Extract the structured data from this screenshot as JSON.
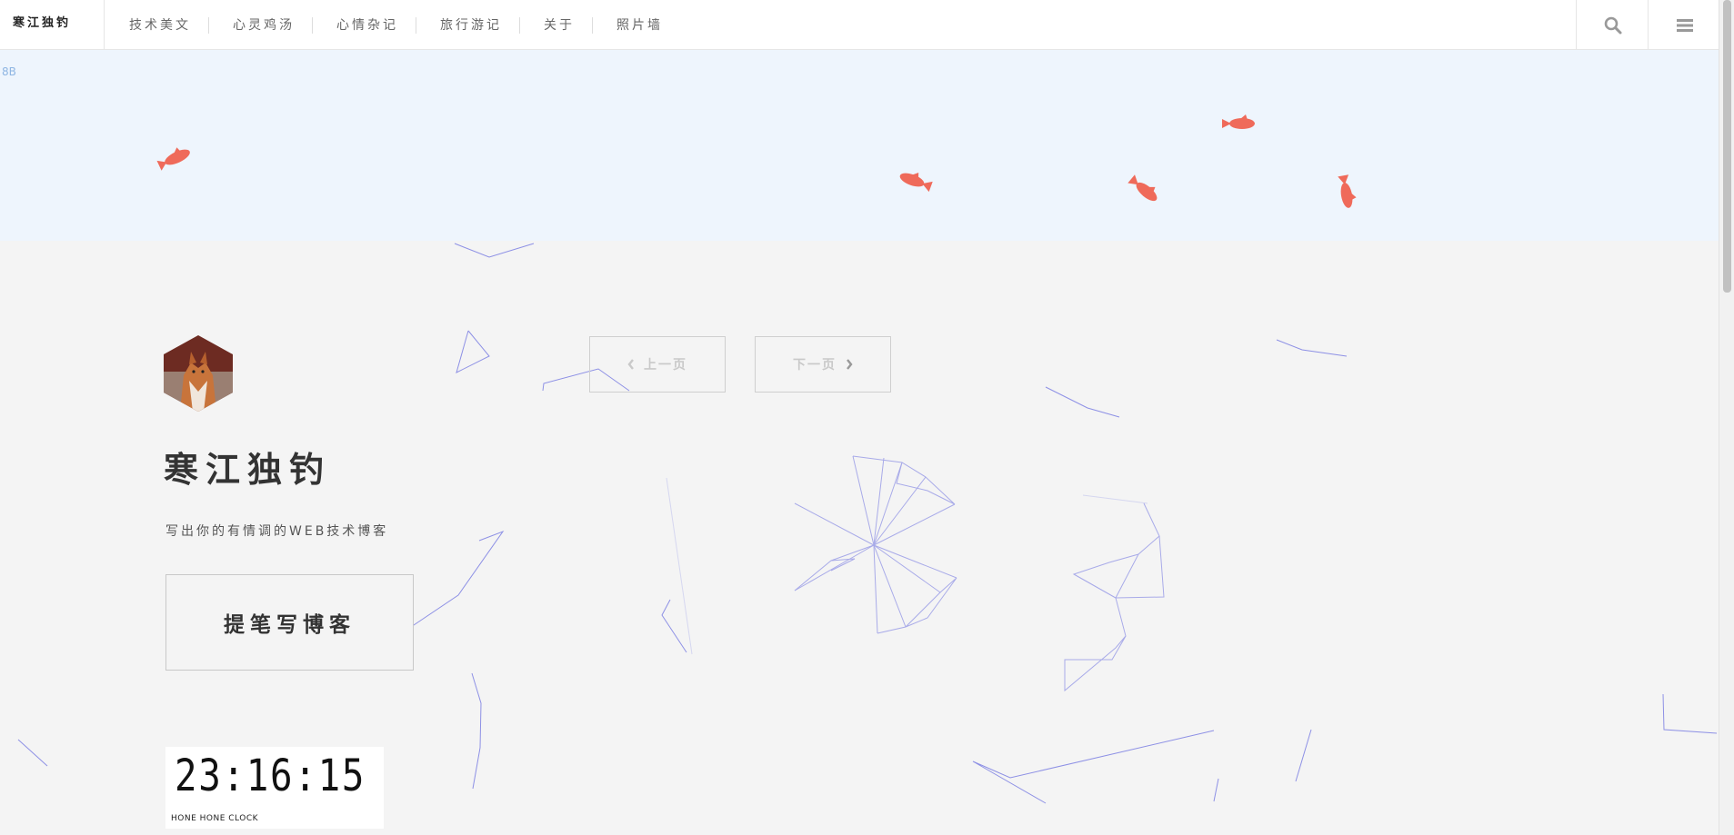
{
  "brand": {
    "title": "寒江独钓"
  },
  "nav": {
    "items": [
      {
        "label": "技术美文"
      },
      {
        "label": "心灵鸡汤"
      },
      {
        "label": "心情杂记"
      },
      {
        "label": "旅行游记"
      },
      {
        "label": "关于"
      },
      {
        "label": "照片墙"
      }
    ],
    "search_icon": "search-icon",
    "menu_icon": "hamburger-menu-icon"
  },
  "banner": {
    "corner_mark": "8B"
  },
  "hero": {
    "title": "寒江独钓",
    "tagline": "写出你的有情调的WEB技术博客",
    "write_button": "提笔写博客"
  },
  "pager": {
    "prev_label": "上一页",
    "next_label": "下一页"
  },
  "clock": {
    "time": "23:16:15",
    "label": "HONE HONE CLOCK"
  },
  "colors": {
    "fish": "#ef6a5a",
    "network": "#6b6fe0",
    "banner_bg": "#eef5fd",
    "page_bg": "#f4f4f4"
  }
}
